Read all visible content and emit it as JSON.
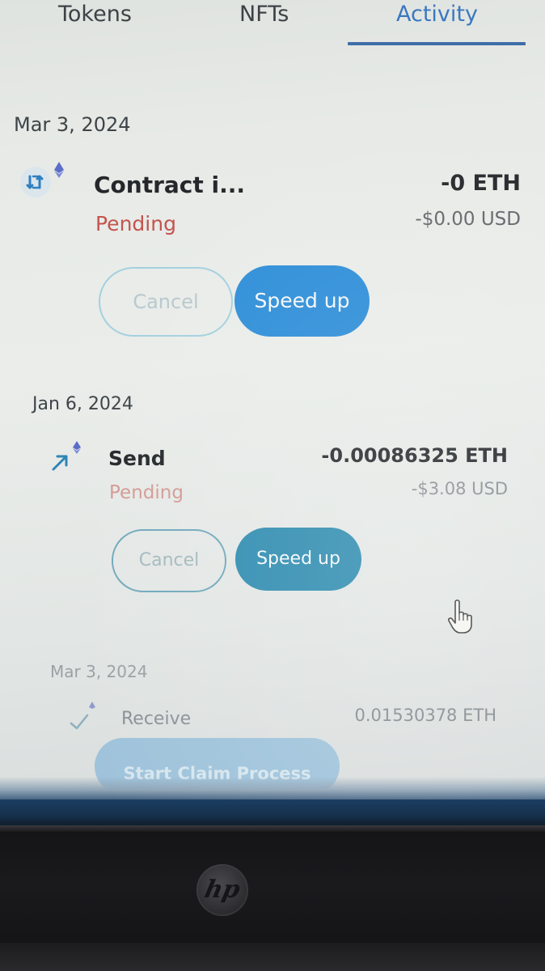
{
  "tabs": [
    {
      "label": "Tokens"
    },
    {
      "label": "NFTs"
    },
    {
      "label": "Activity",
      "active": true
    }
  ],
  "groups": [
    {
      "date": "Mar 3, 2024",
      "tx": {
        "icon": "contract-interaction-icon",
        "title": "Contract i...",
        "status": "Pending",
        "amount": "-0 ETH",
        "fiat": "-$0.00 USD",
        "cancel_label": "Cancel",
        "speed_label": "Speed up"
      }
    },
    {
      "date": "Jan 6, 2024",
      "tx": {
        "icon": "send-arrow-icon",
        "title": "Send",
        "status": "Pending",
        "amount": "-0.00086325 ETH",
        "fiat": "-$3.08 USD",
        "cancel_label": "Cancel",
        "speed_label": "Speed up"
      }
    },
    {
      "date": "Mar 3, 2024",
      "tx": {
        "icon": "receive-check-icon",
        "title": "Receive",
        "amount": "0.01530378 ETH",
        "action_label": "Start Claim Process"
      }
    }
  ],
  "colors": {
    "accent": "#3a78c0",
    "pending": "#c4534e",
    "speed_button": "#2f8fd6",
    "cancel_border": "#8fc2d6"
  },
  "device": {
    "brand_logo": "hp-logo"
  }
}
